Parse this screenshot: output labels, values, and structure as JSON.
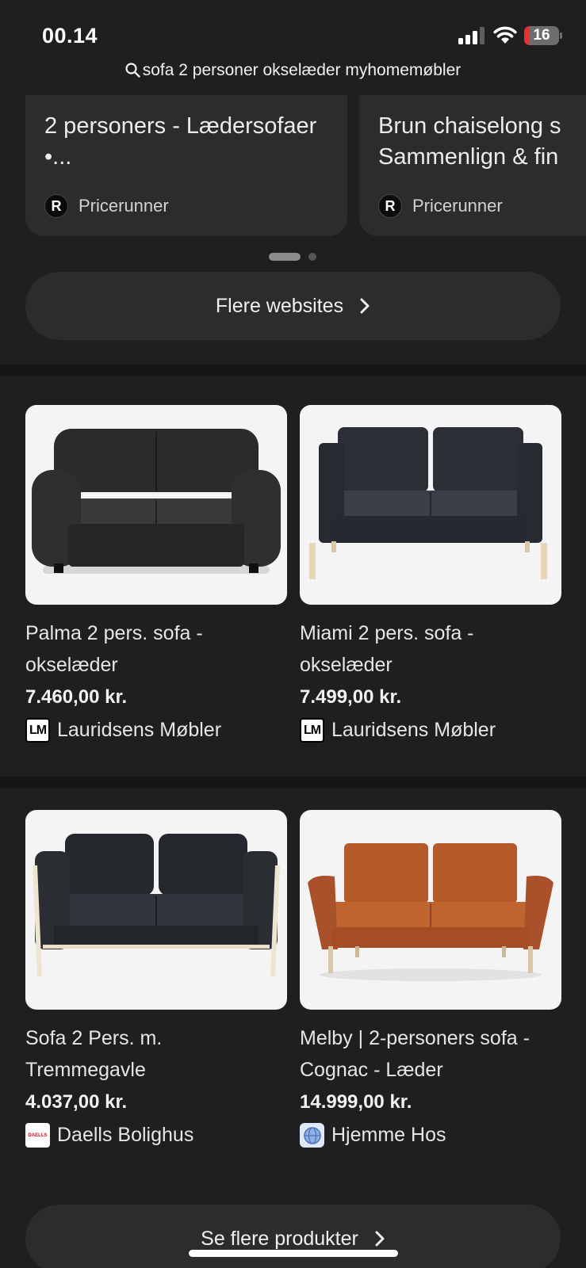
{
  "status_bar": {
    "time": "00.14",
    "battery": "16",
    "battery_level": 0.16
  },
  "search": {
    "query": "sofa 2 personer okselæder myhomemøbler"
  },
  "website_cards": [
    {
      "title": "2 personers - Lædersofaer •...",
      "source": "Pricerunner",
      "source_logo": "R"
    },
    {
      "title": "Brun chaiselong s Sammenlign & fin",
      "source": "Pricerunner",
      "source_logo": "R"
    }
  ],
  "more_websites": {
    "label": "Flere websites"
  },
  "products": [
    {
      "title": "Palma 2 pers. sofa - okselæder",
      "price": "7.460,00 kr.",
      "store": "Lauridsens Møbler",
      "store_logo": "LM",
      "color": "#2b2b2d"
    },
    {
      "title": "Miami 2 pers. sofa - okselæder",
      "price": "7.499,00 kr.",
      "store": "Lauridsens Møbler",
      "store_logo": "LM",
      "color": "#2c3036"
    },
    {
      "title": "Sofa 2 Pers. m. Tremmegavle",
      "price": "4.037,00 kr.",
      "store": "Daells Bolighus",
      "store_logo": "DAELLS",
      "color": "#25282c"
    },
    {
      "title": "Melby | 2-personers sofa - Cognac - Læder",
      "price": "14.999,00 kr.",
      "store": "Hjemme Hos",
      "store_logo": "globe-icon",
      "color": "#b3592a"
    }
  ],
  "more_products": {
    "label": "Se flere produkter"
  }
}
